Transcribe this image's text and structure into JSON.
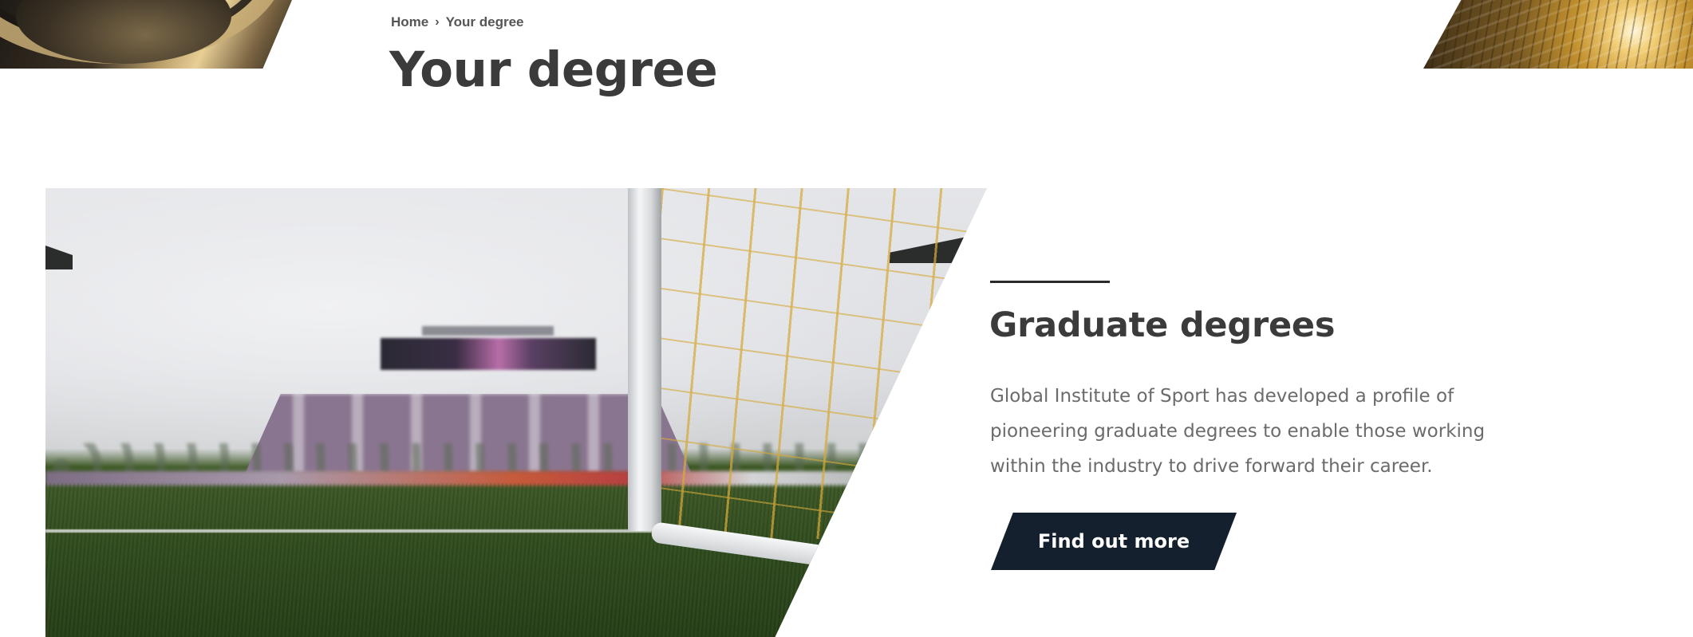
{
  "breadcrumb": {
    "items": [
      {
        "label": "Home"
      },
      {
        "label": "Your degree"
      }
    ],
    "separator_icon": "chevron-right-icon"
  },
  "page": {
    "title": "Your degree"
  },
  "header_images": {
    "left": "helmet-image",
    "right": "stadium-seats-image"
  },
  "hero": {
    "image": "stadium-goal-net-image"
  },
  "section": {
    "title": "Graduate degrees",
    "body": "Global Institute of Sport has developed a profile of pioneering graduate degrees to enable those working within the industry to drive forward their career.",
    "cta_label": "Find out more"
  },
  "colors": {
    "button_bg": "#14202e",
    "heading": "#3b3b3b",
    "body_text": "#6b6b6b"
  }
}
